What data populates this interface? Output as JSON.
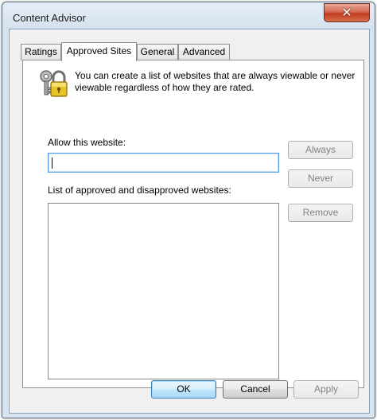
{
  "window": {
    "title": "Content Advisor",
    "close_symbol": "✕"
  },
  "tabs": [
    {
      "label": "Ratings",
      "active": false
    },
    {
      "label": "Approved Sites",
      "active": true
    },
    {
      "label": "General",
      "active": false
    },
    {
      "label": "Advanced",
      "active": false
    }
  ],
  "approved_sites": {
    "icon": "key-lock-icon",
    "description": "You can create a list of websites that are always viewable or never viewable regardless of how they are rated.",
    "allow_label": "Allow this website:",
    "allow_value": "",
    "list_label": "List of approved and disapproved websites:",
    "list_items": [],
    "always_button": "Always",
    "never_button": "Never",
    "remove_button": "Remove"
  },
  "footer": {
    "ok_button": "OK",
    "cancel_button": "Cancel",
    "apply_button": "Apply"
  },
  "colors": {
    "title_bar": "#d8e5f1",
    "close_button": "#c23a22",
    "focus_border": "#569de5",
    "disabled_text": "#838383"
  }
}
